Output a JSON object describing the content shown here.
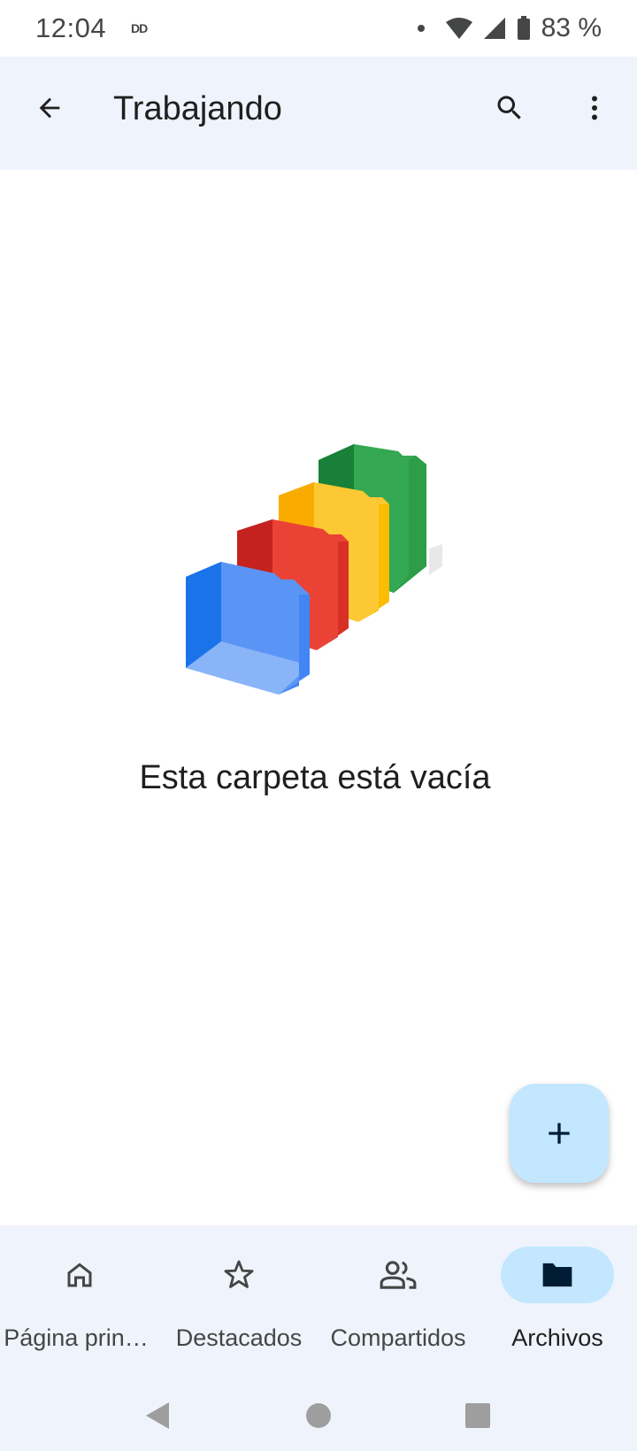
{
  "status_bar": {
    "time": "12:04",
    "notification": "DD",
    "battery": "83 %"
  },
  "app_bar": {
    "title": "Trabajando"
  },
  "empty_state": {
    "message": "Esta carpeta está vacía"
  },
  "fab": {
    "icon": "plus-icon"
  },
  "bottom_nav": {
    "items": [
      {
        "label": "Página prin…",
        "icon": "home-icon",
        "active": false
      },
      {
        "label": "Destacados",
        "icon": "star-icon",
        "active": false
      },
      {
        "label": "Compartidos",
        "icon": "people-icon",
        "active": false
      },
      {
        "label": "Archivos",
        "icon": "folder-icon",
        "active": true
      }
    ]
  },
  "colors": {
    "app_bar_bg": "#eff3fc",
    "accent_container": "#c2e7ff",
    "folder_blue": "#4285f4",
    "folder_red": "#ea4335",
    "folder_yellow": "#fbbc04",
    "folder_green": "#34a853"
  }
}
